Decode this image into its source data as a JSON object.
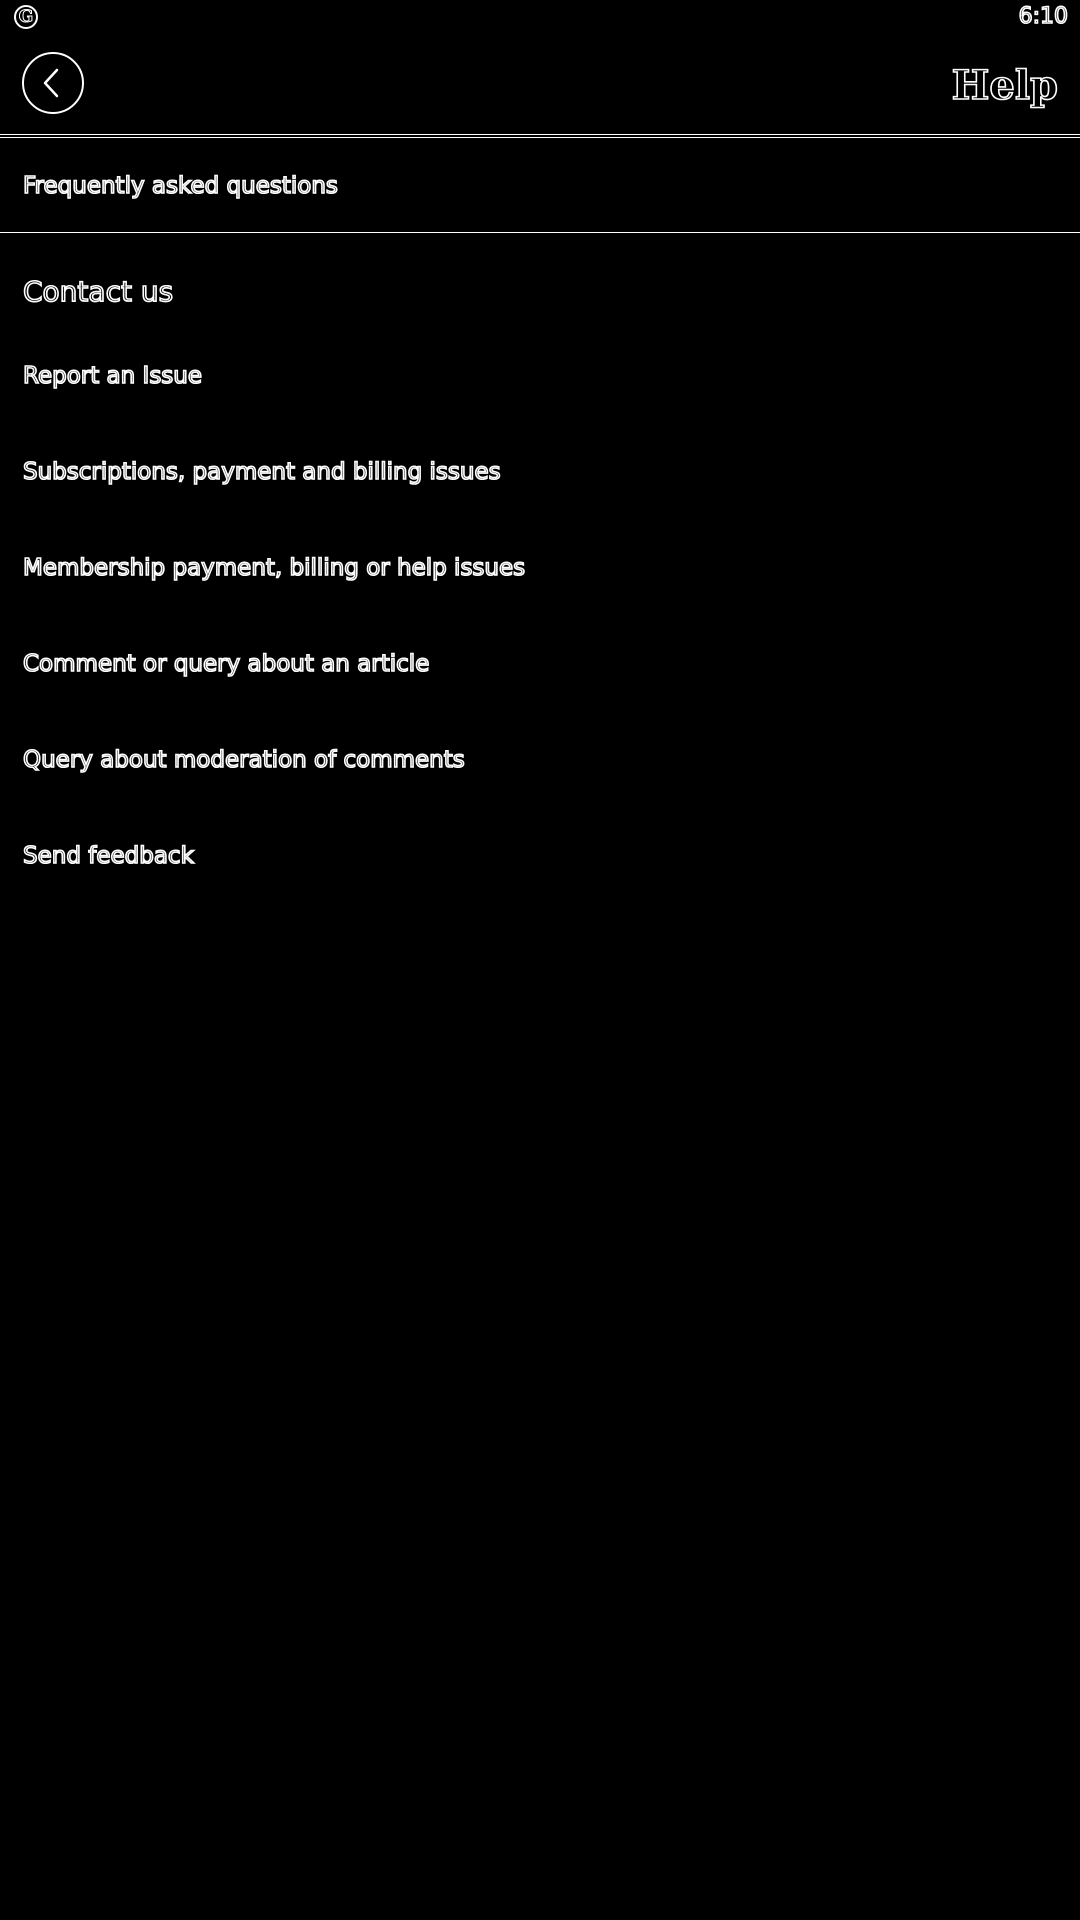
{
  "status_bar": {
    "app_logo": "G",
    "time": "6:10"
  },
  "header": {
    "back_icon": "chevron-left-icon",
    "title": "Help"
  },
  "faq": {
    "label": "Frequently asked questions"
  },
  "contact": {
    "heading": "Contact us",
    "items": [
      {
        "label": "Report an Issue"
      },
      {
        "label": "Subscriptions, payment and billing issues"
      },
      {
        "label": "Membership payment, billing or help issues"
      },
      {
        "label": "Comment or query about an article"
      },
      {
        "label": "Query about moderation of comments"
      },
      {
        "label": "Send feedback"
      }
    ]
  },
  "colors": {
    "background": "#000000",
    "foreground": "#ffffff"
  }
}
